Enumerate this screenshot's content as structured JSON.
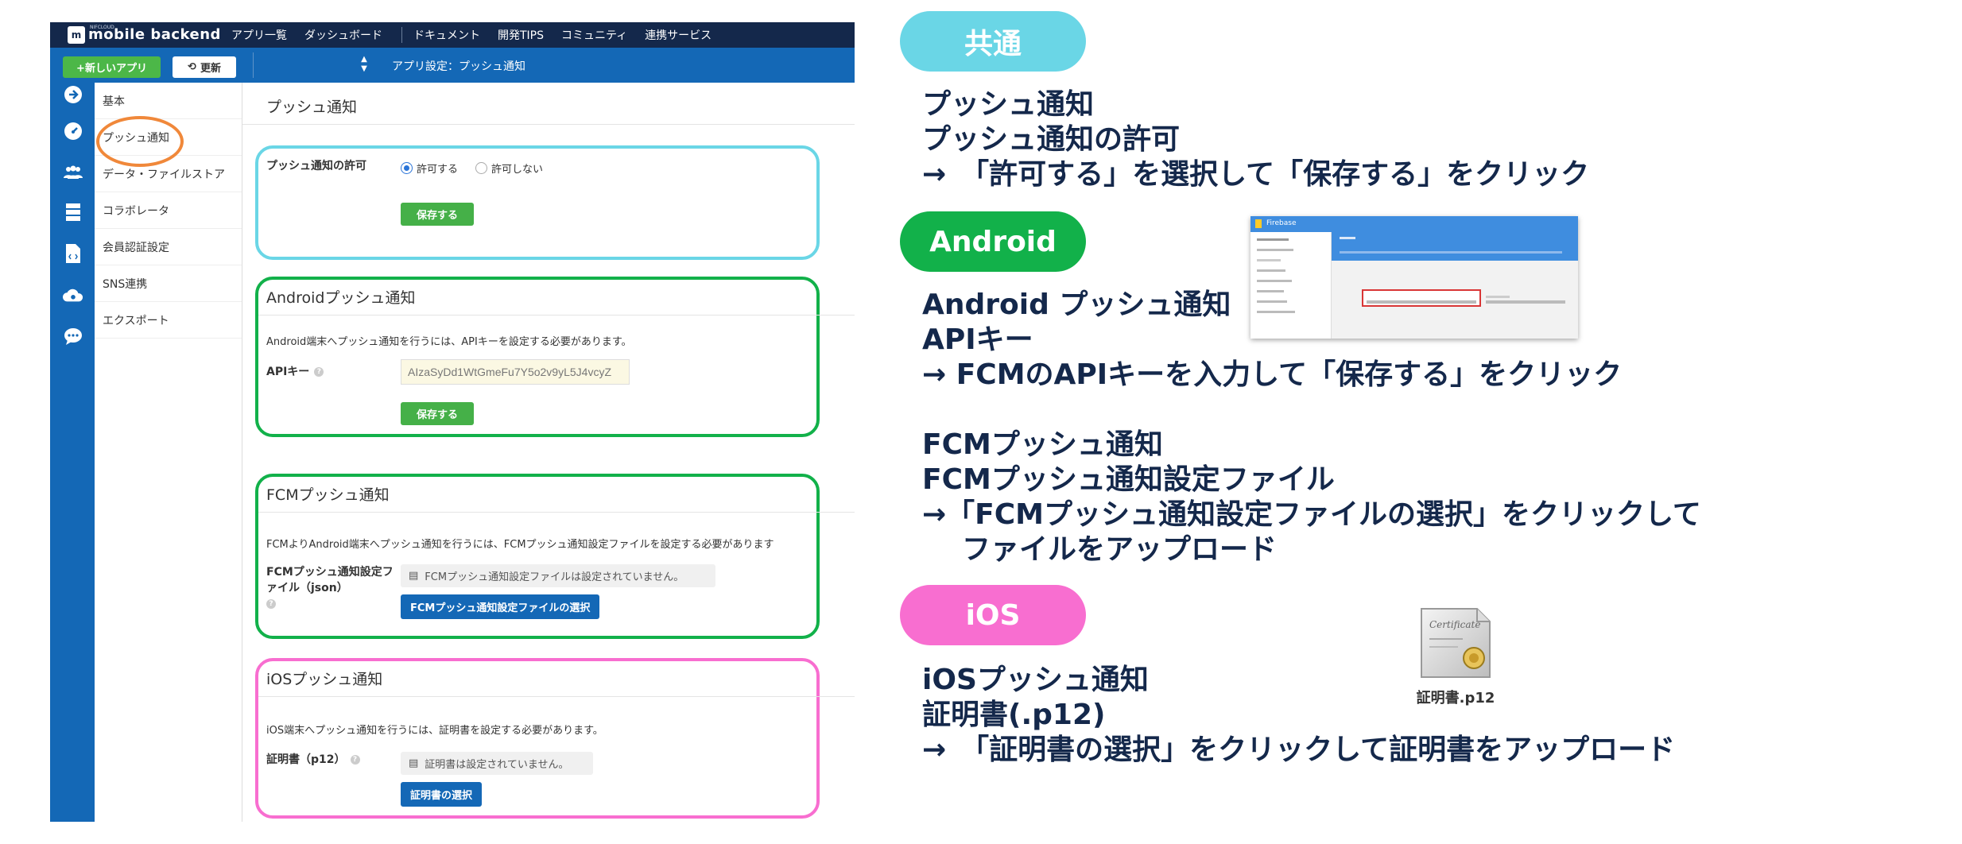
{
  "topbar": {
    "logo_mark": "m",
    "logo_sub": "NIFCLOUD",
    "logo_text": "mobile backend",
    "nav": [
      "アプリ一覧",
      "ダッシュボード",
      "ドキュメント",
      "開発TIPS",
      "コミュニティ",
      "連携サービス"
    ]
  },
  "subbar": {
    "new_app": "+新しいアプリ",
    "refresh": "更新",
    "app_setting": "アプリ設定：プッシュ通知"
  },
  "sidemenu": {
    "items": [
      "基本",
      "プッシュ通知",
      "データ・ファイルストア",
      "コラボレータ",
      "会員認証設定",
      "SNS連携",
      "エクスポート"
    ]
  },
  "main": {
    "title": "プッシュ通知",
    "common": {
      "label": "プッシュ通知の許可",
      "allow": "許可する",
      "deny": "許可しない",
      "selected": "許可する",
      "save": "保存する"
    },
    "android": {
      "title": "Androidプッシュ通知",
      "desc": "Android端末へプッシュ通知を行うには、APIキーを設定する必要があります。",
      "api_label": "APIキー",
      "api_value": "AIzaSyDd1WtGmeFu7Y5o2v9yL5J4vcyZ",
      "save": "保存する"
    },
    "fcm": {
      "title": "FCMプッシュ通知",
      "desc": "FCMよりAndroid端末へプッシュ通知を行うには、FCMプッシュ通知設定ファイルを設定する必要があります",
      "label": "FCMプッシュ通知設定ファイル（json）",
      "status": "FCMプッシュ通知設定ファイルは設定されていません。",
      "button": "FCMプッシュ通知設定ファイルの選択"
    },
    "ios": {
      "title": "iOSプッシュ通知",
      "desc": "iOS端末へプッシュ通知を行うには、証明書を設定する必要があります。",
      "label": "証明書（p12）",
      "status": "証明書は設定されていません。",
      "button": "証明書の選択"
    }
  },
  "guide": {
    "common_pill": "共通",
    "common_lines": [
      "プッシュ通知",
      "プッシュ通知の許可",
      "→　「許可する」を選択して「保存する」をクリック"
    ],
    "android_pill": "Android",
    "android_lines": [
      "Android プッシュ通知",
      "APIキー",
      "→ FCMのAPIキーを入力して「保存する」をクリック"
    ],
    "fcm_lines": [
      "FCMプッシュ通知",
      "FCMプッシュ通知設定ファイル",
      "→「FCMプッシュ通知設定ファイルの選択」をクリックして",
      "ファイルをアップロード"
    ],
    "ios_pill": "iOS",
    "ios_lines": [
      "iOSプッシュ通知",
      "証明書(.p12)",
      "→　「証明書の選択」をクリックして証明書をアップロード"
    ],
    "firebase_title": "Firebase",
    "cert_filename": "証明書.p12",
    "cert_script": "Certificate"
  },
  "colors": {
    "navy": "#14284b",
    "blue": "#1468b6",
    "green": "#45b048",
    "common_cyan": "#6ad6e6",
    "android_green": "#12b14a",
    "ios_pink": "#f86ed0",
    "circle_orange": "#f0883a"
  }
}
